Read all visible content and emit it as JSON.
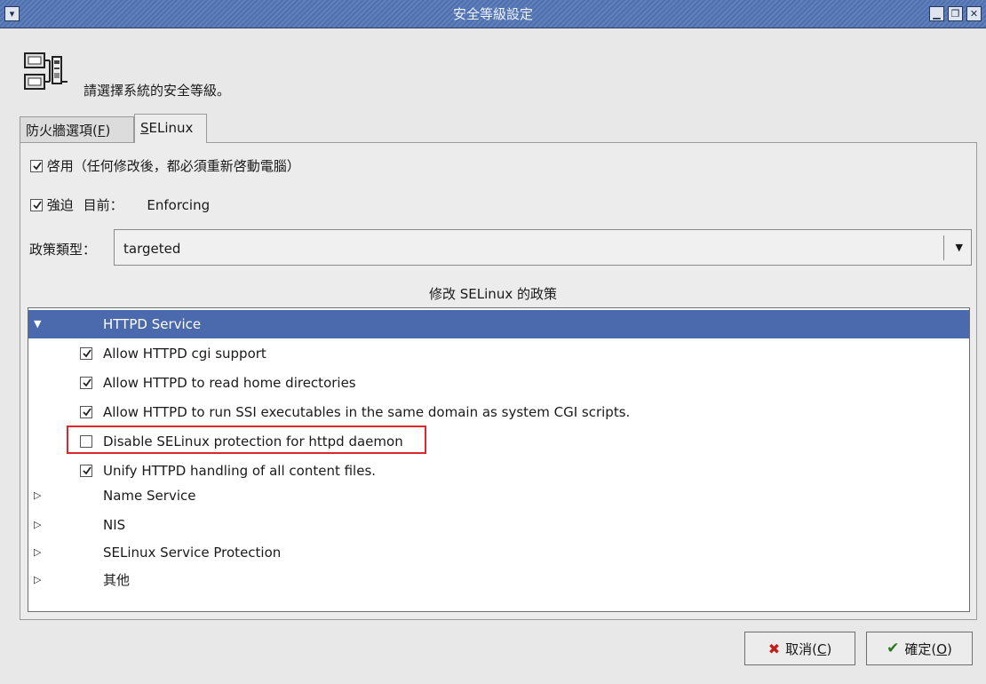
{
  "window": {
    "title": "安全等級設定"
  },
  "header": {
    "text": "請選擇系統的安全等級。"
  },
  "tabs": [
    {
      "label": "防火牆選項(",
      "key": "F",
      "suffix": ")"
    },
    {
      "label": "",
      "key": "S",
      "suffix": "ELinux"
    }
  ],
  "selinux": {
    "enable_label": "啓用（任何修改後，都必須重新啓動電腦）",
    "enable_checked": true,
    "enforce_label": "強迫",
    "enforce_checked": true,
    "current_label": "目前：",
    "current_value": "Enforcing",
    "policy_label": "政策類型：",
    "policy_value": "targeted",
    "section_title": "修改 SELinux 的政策"
  },
  "tree": {
    "group_expanded": "HTTPD Service",
    "items": [
      {
        "label": "Allow HTTPD cgi support",
        "checked": true
      },
      {
        "label": "Allow HTTPD to read home directories",
        "checked": true
      },
      {
        "label": "Allow HTTPD to run SSI executables in the same domain as system CGI scripts.",
        "checked": true
      },
      {
        "label": "Disable SELinux protection for httpd daemon",
        "checked": false
      },
      {
        "label": "Unify HTTPD handling of all content files.",
        "checked": true
      }
    ],
    "collapsed_groups": [
      "Name Service",
      "NIS",
      "SELinux Service Protection",
      "其他"
    ]
  },
  "buttons": {
    "cancel_label": "取消(",
    "cancel_key": "C",
    "cancel_suffix": ")",
    "ok_label": "確定(",
    "ok_key": "O",
    "ok_suffix": ")"
  },
  "colors": {
    "selection": "#4b6aad",
    "highlight": "#e0262a"
  },
  "icons": [
    "window-menu-icon",
    "minimize-icon",
    "maximize-icon",
    "close-icon",
    "security-computers-icon",
    "cancel-x-icon",
    "ok-check-icon"
  ]
}
